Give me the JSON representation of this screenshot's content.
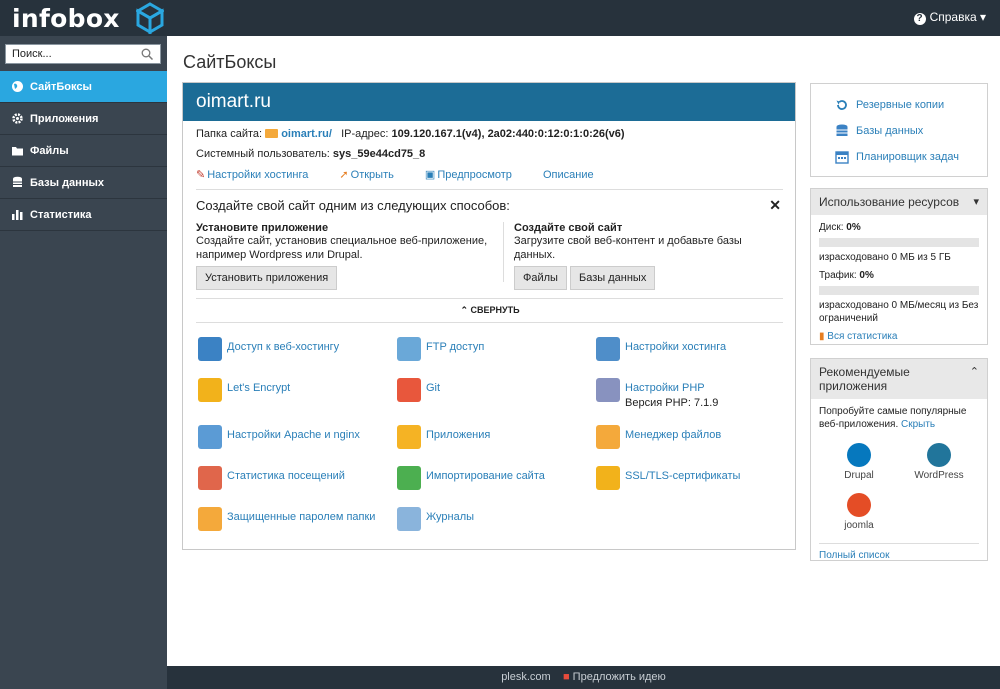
{
  "topbar": {
    "logo": "infobox",
    "help_icon": "?",
    "help_label": "Справка ▾"
  },
  "sidebar": {
    "search_placeholder": "Поиск...",
    "items": [
      {
        "label": "СайтБоксы",
        "icon": "globe-icon",
        "active": true
      },
      {
        "label": "Приложения",
        "icon": "gear-icon",
        "active": false
      },
      {
        "label": "Файлы",
        "icon": "folder-icon",
        "active": false
      },
      {
        "label": "Базы данных",
        "icon": "database-icon",
        "active": false
      },
      {
        "label": "Статистика",
        "icon": "bar-chart-icon",
        "active": false
      }
    ]
  },
  "main": {
    "title": "СайтБоксы",
    "site": {
      "domain": "oimart.ru",
      "folder_label": "Папка сайта:",
      "folder_value": "oimart.ru/",
      "ip_label": "IP-адрес:",
      "ip_value": "109.120.167.1(v4), 2a02:440:0:12:0:1:0:26(v6)",
      "user_label": "Системный пользователь:",
      "user_value": "sys_59e44cd75_8",
      "links": [
        "Настройки хостинга",
        "Открыть",
        "Предпросмотр",
        "Описание"
      ],
      "create_title": "Создайте свой сайт одним из следующих способов:",
      "close": "✕",
      "option_app": {
        "title": "Установите приложение",
        "text": "Создайте сайт, установив специальное веб-приложение, например Wordpress или Drupal.",
        "button": "Установить приложения"
      },
      "option_own": {
        "title": "Создайте свой сайт",
        "text": "Загрузите свой веб-контент и добавьте базы данных.",
        "button_files": "Файлы",
        "button_db": "Базы данных"
      },
      "collapse": "⌃ СВЕРНУТЬ",
      "tools": [
        {
          "label": "Доступ к веб-хостингу",
          "icon": "web-access-icon",
          "color": "#3b82c4"
        },
        {
          "label": "FTP доступ",
          "icon": "ftp-icon",
          "color": "#6aa8d8"
        },
        {
          "label": "Настройки хостинга",
          "icon": "hosting-settings-icon",
          "color": "#4f8ec9"
        },
        {
          "label": "Let's Encrypt",
          "icon": "lets-encrypt-icon",
          "color": "#f2b21b"
        },
        {
          "label": "Git",
          "icon": "git-icon",
          "color": "#e8573c"
        },
        {
          "label": "Настройки PHP",
          "icon": "php-icon",
          "color": "#8892bf",
          "sub": "Версия PHP: 7.1.9"
        },
        {
          "label": "Настройки Apache и nginx",
          "icon": "apache-icon",
          "color": "#5b9bd5"
        },
        {
          "label": "Приложения",
          "icon": "applications-icon",
          "color": "#f5b324"
        },
        {
          "label": "Менеджер файлов",
          "icon": "file-manager-icon",
          "color": "#f4a93b"
        },
        {
          "label": "Статистика посещений",
          "icon": "visit-stats-icon",
          "color": "#e0664b"
        },
        {
          "label": "Импортирование сайта",
          "icon": "import-site-icon",
          "color": "#4caf50"
        },
        {
          "label": "SSL/TLS-сертификаты",
          "icon": "ssl-icon",
          "color": "#f2b21b"
        },
        {
          "label": "Защищенные паролем папки",
          "icon": "protected-folder-icon",
          "color": "#f4a93b"
        },
        {
          "label": "Журналы",
          "icon": "logs-icon",
          "color": "#8ab4dc"
        }
      ]
    }
  },
  "right": {
    "quick_links": [
      {
        "label": "Резервные копии",
        "icon": "backup-icon"
      },
      {
        "label": "Базы данных",
        "icon": "database-icon"
      },
      {
        "label": "Планировщик задач",
        "icon": "calendar-icon"
      }
    ],
    "usage": {
      "title": "Использование ресурсов",
      "disk_label": "Диск:",
      "disk_value": "0%",
      "disk_fraction": 0,
      "disk_text": "израсходовано 0 МБ из 5 ГБ",
      "traffic_label": "Трафик:",
      "traffic_value": "0%",
      "traffic_fraction": 0,
      "traffic_text": "израсходовано 0 МБ/месяц из Без ограничений",
      "all_stats": "Вся статистика"
    },
    "apps": {
      "title": "Рекомендуемые приложения",
      "intro": "Попробуйте самые популярные веб-приложения.",
      "hide": "Скрыть",
      "items": [
        {
          "name": "Drupal",
          "color": "#0678be"
        },
        {
          "name": "WordPress",
          "color": "#21759b"
        },
        {
          "name": "joomla",
          "color": "#e44d26"
        }
      ],
      "full_list": "Полный список"
    }
  },
  "footer": {
    "link1": "plesk.com",
    "link2": "Предложить идею"
  }
}
